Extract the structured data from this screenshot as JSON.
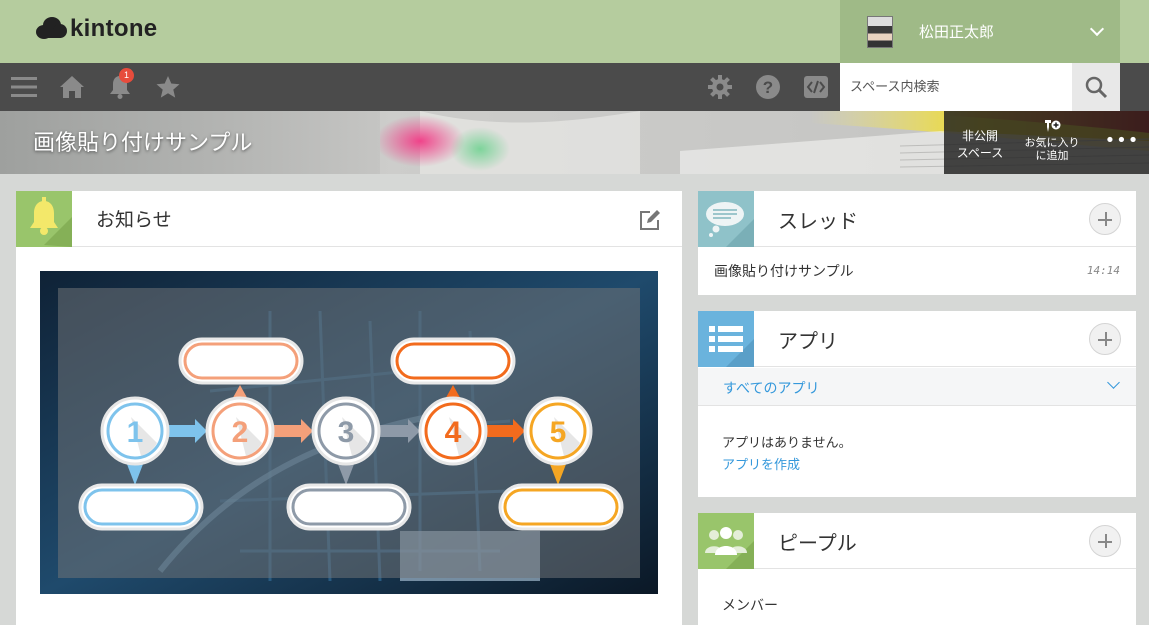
{
  "header": {
    "logo_text": "kintone",
    "user_name": "松田正太郎"
  },
  "nav": {
    "notification_count": "1",
    "search": {
      "placeholder": "スペース内検索",
      "value": ""
    }
  },
  "space": {
    "title": "画像貼り付けサンプル",
    "private_label_line1": "非公開",
    "private_label_line2": "スペース",
    "favorite_label_line1": "お気に入り",
    "favorite_label_line2": "に追加",
    "more_label": "•••"
  },
  "notice": {
    "title": "お知らせ",
    "steps": [
      "1",
      "2",
      "3",
      "4",
      "5"
    ]
  },
  "thread": {
    "title": "スレッド",
    "items": [
      {
        "name": "画像貼り付けサンプル",
        "time": "14:14"
      }
    ]
  },
  "apps": {
    "title": "アプリ",
    "filter_label": "すべてのアプリ",
    "empty_text": "アプリはありません。",
    "create_link": "アプリを作成"
  },
  "people": {
    "title": "ピープル",
    "members_label": "メンバー"
  },
  "colors": {
    "header_green": "#b5cc9e",
    "nav_dark": "#4b4b4b",
    "link_blue": "#3498db",
    "notice_icon_bg": "#99c56b",
    "thread_icon_bg": "#8fc2c9",
    "apps_icon_bg": "#6ab3dd",
    "people_icon_bg": "#99c56b"
  }
}
